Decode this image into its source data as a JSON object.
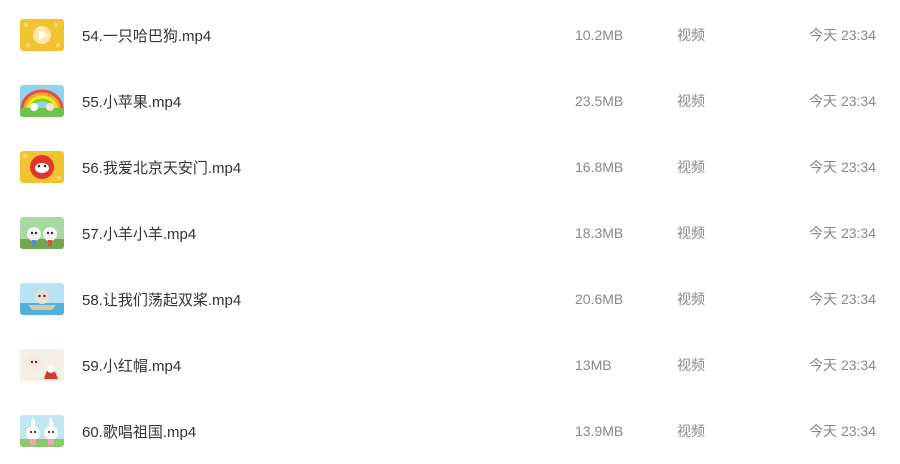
{
  "files": [
    {
      "name": "54.一只哈巴狗.mp4",
      "size": "10.2MB",
      "type": "视频",
      "modified": "今天 23:34",
      "thumb_icon": "video-thumbnail-play-icon"
    },
    {
      "name": "55.小苹果.mp4",
      "size": "23.5MB",
      "type": "视频",
      "modified": "今天 23:34",
      "thumb_icon": "video-thumbnail-rainbow-icon"
    },
    {
      "name": "56.我爱北京天安门.mp4",
      "size": "16.8MB",
      "type": "视频",
      "modified": "今天 23:34",
      "thumb_icon": "video-thumbnail-red-circle-icon"
    },
    {
      "name": "57.小羊小羊.mp4",
      "size": "18.3MB",
      "type": "视频",
      "modified": "今天 23:34",
      "thumb_icon": "video-thumbnail-sheep-icon"
    },
    {
      "name": "58.让我们荡起双桨.mp4",
      "size": "20.6MB",
      "type": "视频",
      "modified": "今天 23:34",
      "thumb_icon": "video-thumbnail-boat-icon"
    },
    {
      "name": "59.小红帽.mp4",
      "size": "13MB",
      "type": "视频",
      "modified": "今天 23:34",
      "thumb_icon": "video-thumbnail-red-hood-icon"
    },
    {
      "name": "60.歌唱祖国.mp4",
      "size": "13.9MB",
      "type": "视频",
      "modified": "今天 23:34",
      "thumb_icon": "video-thumbnail-bunnies-icon"
    }
  ],
  "colors": {
    "text_primary": "#333333",
    "text_secondary": "#888888",
    "thumb_yellow": "#f2c230",
    "thumb_red": "#e0362a"
  }
}
